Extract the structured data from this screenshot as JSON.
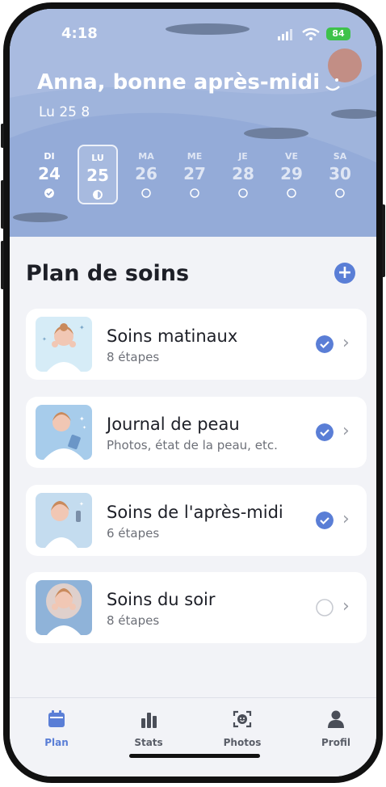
{
  "status_bar": {
    "time": "4:18",
    "battery": "84",
    "icons": [
      "signal-icon",
      "wifi-icon",
      "battery-icon"
    ]
  },
  "header": {
    "greeting": "Anna, bonne après-midi",
    "date": "Lu 25 8",
    "week": [
      {
        "name": "DI",
        "num": "24",
        "state": "done"
      },
      {
        "name": "LU",
        "num": "25",
        "state": "half",
        "selected": true
      },
      {
        "name": "MA",
        "num": "26",
        "state": "empty"
      },
      {
        "name": "ME",
        "num": "27",
        "state": "empty"
      },
      {
        "name": "JE",
        "num": "28",
        "state": "empty"
      },
      {
        "name": "VE",
        "num": "29",
        "state": "empty"
      },
      {
        "name": "SA",
        "num": "30",
        "state": "empty"
      }
    ]
  },
  "plan": {
    "title": "Plan de soins",
    "items": [
      {
        "title": "Soins matinaux",
        "subtitle": "8 étapes",
        "done": true
      },
      {
        "title": "Journal de peau",
        "subtitle": "Photos, état de la peau, etc.",
        "done": true
      },
      {
        "title": "Soins de l'après-midi",
        "subtitle": "6 étapes",
        "done": true
      },
      {
        "title": "Soins du soir",
        "subtitle": "8 étapes",
        "done": false
      }
    ]
  },
  "tabbar": {
    "tabs": [
      {
        "label": "Plan",
        "active": true
      },
      {
        "label": "Stats",
        "active": false
      },
      {
        "label": "Photos",
        "active": false
      },
      {
        "label": "Profil",
        "active": false
      }
    ]
  },
  "colors": {
    "accent": "#5a7ed6",
    "hero": "#9fb4dc",
    "background": "#f2f3f7"
  }
}
